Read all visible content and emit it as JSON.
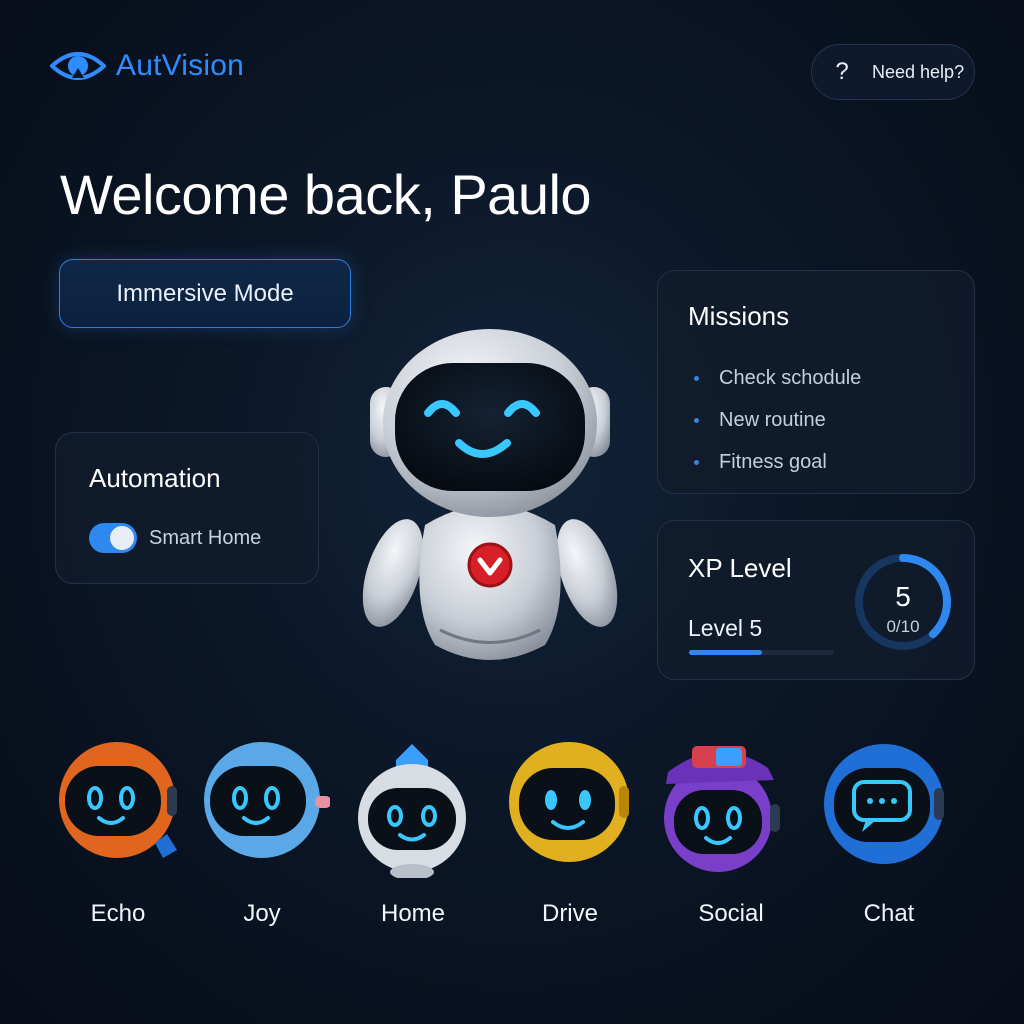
{
  "app": {
    "name": "AutVision"
  },
  "header": {
    "help_icon": "?",
    "help_label": "Need help?"
  },
  "welcome": "Welcome back, Paulo",
  "immersive_button": "Immersive Mode",
  "automation": {
    "title": "Automation",
    "toggle_label": "Smart Home",
    "toggle_on": true
  },
  "missions": {
    "title": "Missions",
    "items": [
      "Check schodule",
      "New routine",
      "Fitness goal"
    ]
  },
  "xp": {
    "title": "XP Level",
    "level_label": "Level 5",
    "level_value": "5",
    "progress_text": "0/10",
    "bar_progress": 0.5,
    "gauge_progress": 0.38
  },
  "assistants": [
    {
      "label": "Echo",
      "color": "#e0651f"
    },
    {
      "label": "Joy",
      "color": "#5aa8e8"
    },
    {
      "label": "Home",
      "color": "#d8dde4"
    },
    {
      "label": "Drive",
      "color": "#e0b020"
    },
    {
      "label": "Social",
      "color": "#7a3fc8"
    },
    {
      "label": "Chat",
      "color": "#1f6fd6"
    }
  ],
  "colors": {
    "accent": "#2f87f0",
    "face_glow": "#38c8ff",
    "badge_red": "#d61f26"
  }
}
